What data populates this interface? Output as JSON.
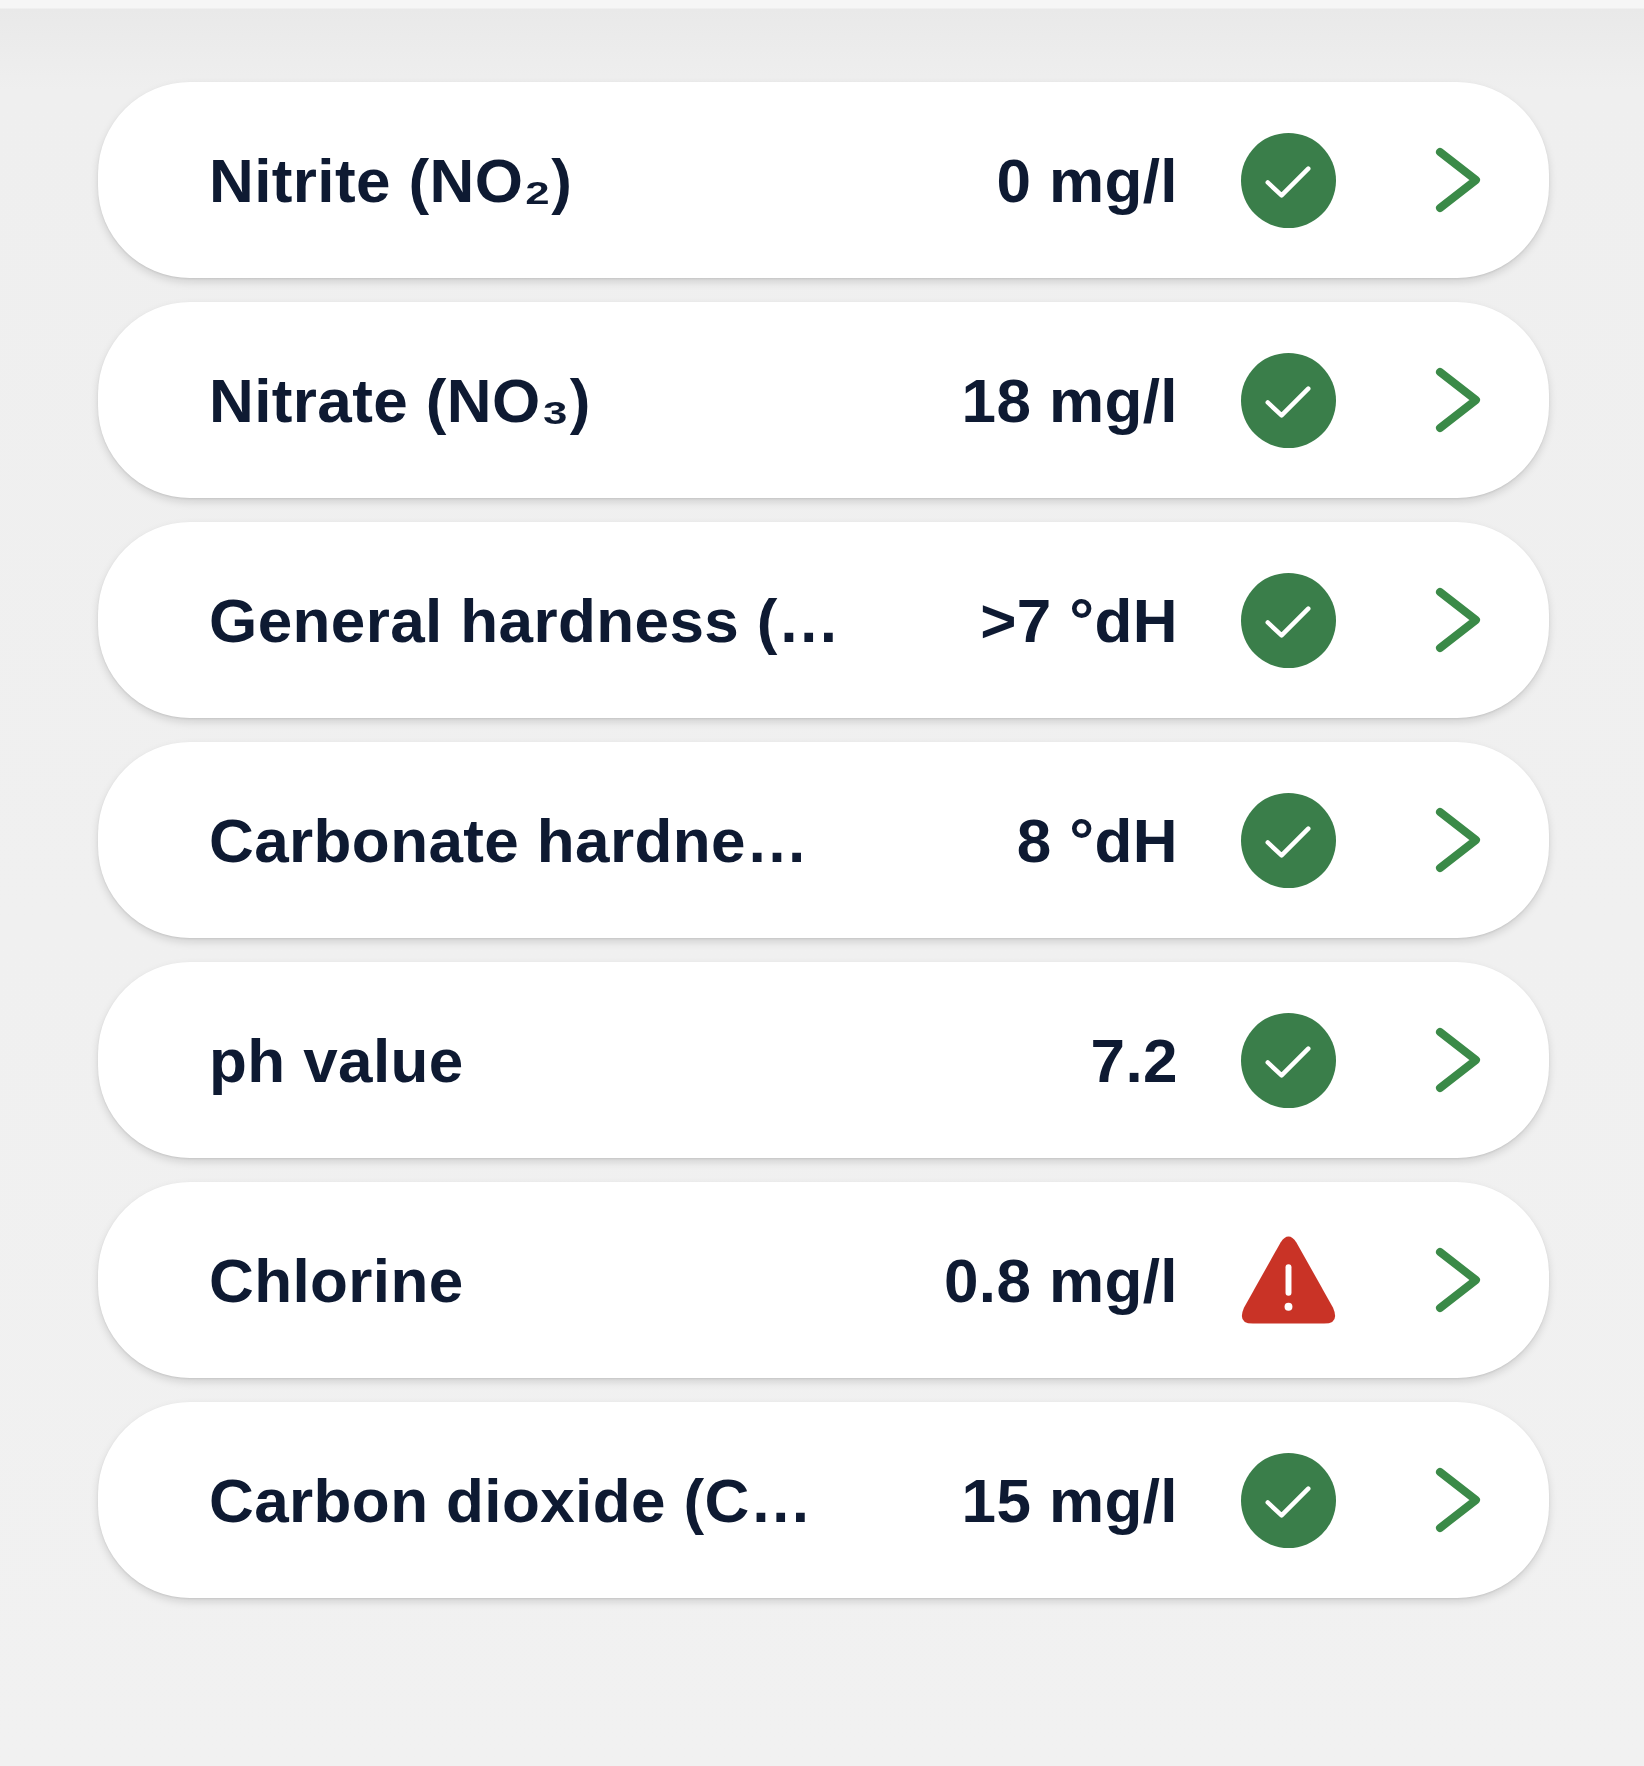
{
  "parameters": [
    {
      "name": "Nitrite (NO₂)",
      "value": "0 mg/l",
      "warning": false
    },
    {
      "name": "Nitrate (NO₃)",
      "value": "18 mg/l",
      "warning": false
    },
    {
      "name": "General hardness (…",
      "value": ">7 °dH",
      "warning": false
    },
    {
      "name": "Carbonate hardne…",
      "value": "8 °dH",
      "warning": false
    },
    {
      "name": "ph value",
      "value": "7.2",
      "warning": false
    },
    {
      "name": "Chlorine",
      "value": "0.8 mg/l",
      "warning": true
    },
    {
      "name": "Carbon dioxide (C…",
      "value": "15 mg/l",
      "warning": false
    }
  ]
}
